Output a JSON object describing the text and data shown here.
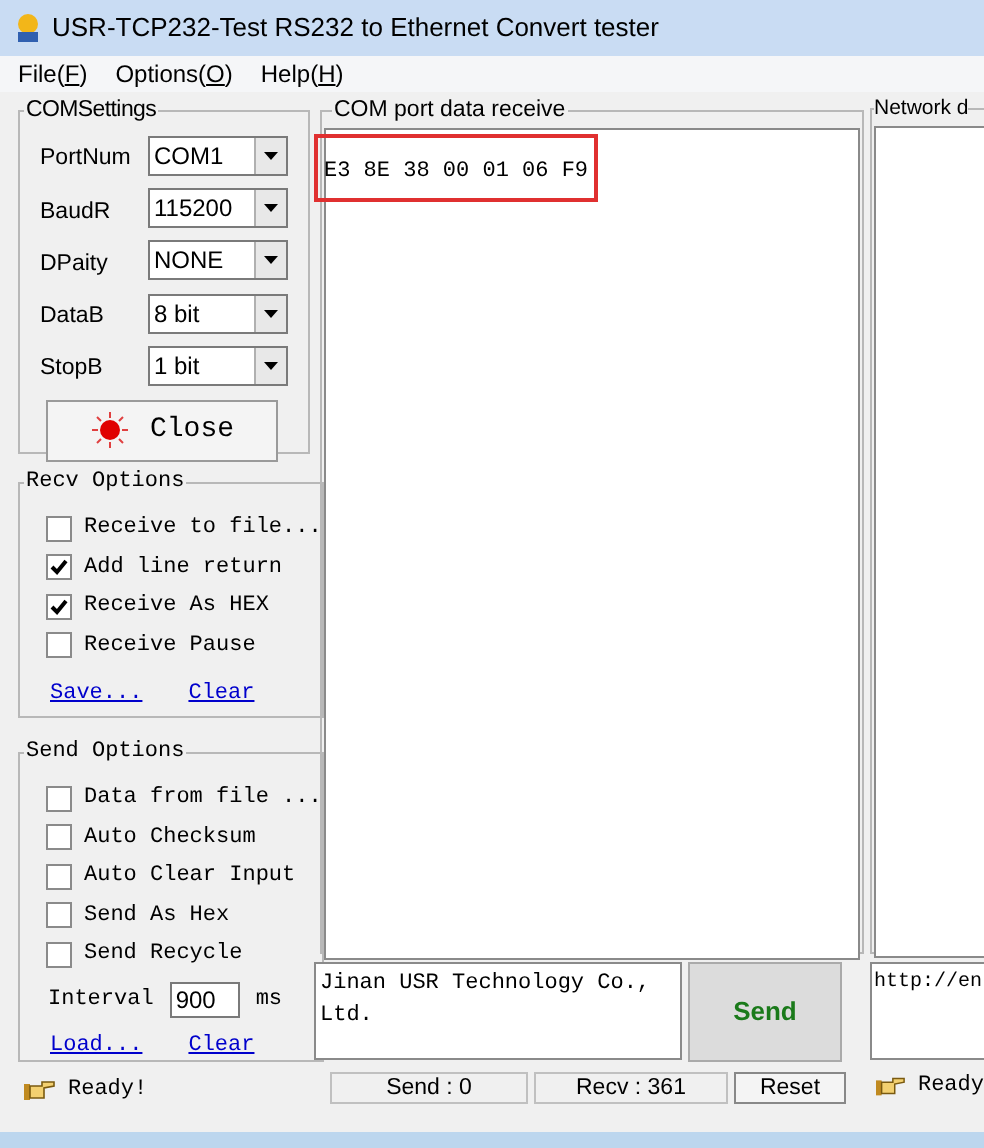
{
  "window": {
    "title": "USR-TCP232-Test  RS232 to Ethernet Convert tester"
  },
  "menu": [
    {
      "before": "File(",
      "key": "F",
      "after": ")"
    },
    {
      "before": "Options(",
      "key": "O",
      "after": ")"
    },
    {
      "before": "Help(",
      "key": "H",
      "after": ")"
    }
  ],
  "com_settings": {
    "title": "COMSettings",
    "fields": [
      {
        "label": "PortNum",
        "value": "COM1"
      },
      {
        "label": "BaudR",
        "value": "115200"
      },
      {
        "label": "DPaity",
        "value": "NONE"
      },
      {
        "label": "DataB",
        "value": "8 bit"
      },
      {
        "label": "StopB",
        "value": "1 bit"
      }
    ],
    "button": "Close"
  },
  "recv_options": {
    "title": "Recv Options",
    "options": [
      {
        "label": "Receive to file...",
        "checked": false
      },
      {
        "label": "Add line return",
        "checked": true
      },
      {
        "label": "Receive As HEX",
        "checked": true
      },
      {
        "label": "Receive Pause",
        "checked": false
      }
    ],
    "links": [
      "Save...",
      "Clear"
    ]
  },
  "send_options": {
    "title": "Send Options",
    "options": [
      {
        "label": "Data from file ...",
        "checked": false
      },
      {
        "label": "Auto Checksum",
        "checked": false
      },
      {
        "label": "Auto Clear Input",
        "checked": false
      },
      {
        "label": "Send As Hex",
        "checked": false
      },
      {
        "label": "Send Recycle",
        "checked": false
      }
    ],
    "interval": {
      "label": "Interval",
      "value": "900",
      "unit": "ms"
    },
    "links": [
      "Load...",
      "Clear"
    ]
  },
  "left_status": "Ready!",
  "receive_panel": {
    "title": "COM port data receive",
    "content": "E3 8E 38 00 01 06 F9"
  },
  "network_panel": {
    "title": "Network d"
  },
  "send_input": "Jinan USR Technology Co., Ltd.",
  "send_button": "Send",
  "network_input": "http://en",
  "status": {
    "send": "Send : 0",
    "recv": "Recv : 361",
    "reset": "Reset"
  },
  "right_status": "Ready"
}
